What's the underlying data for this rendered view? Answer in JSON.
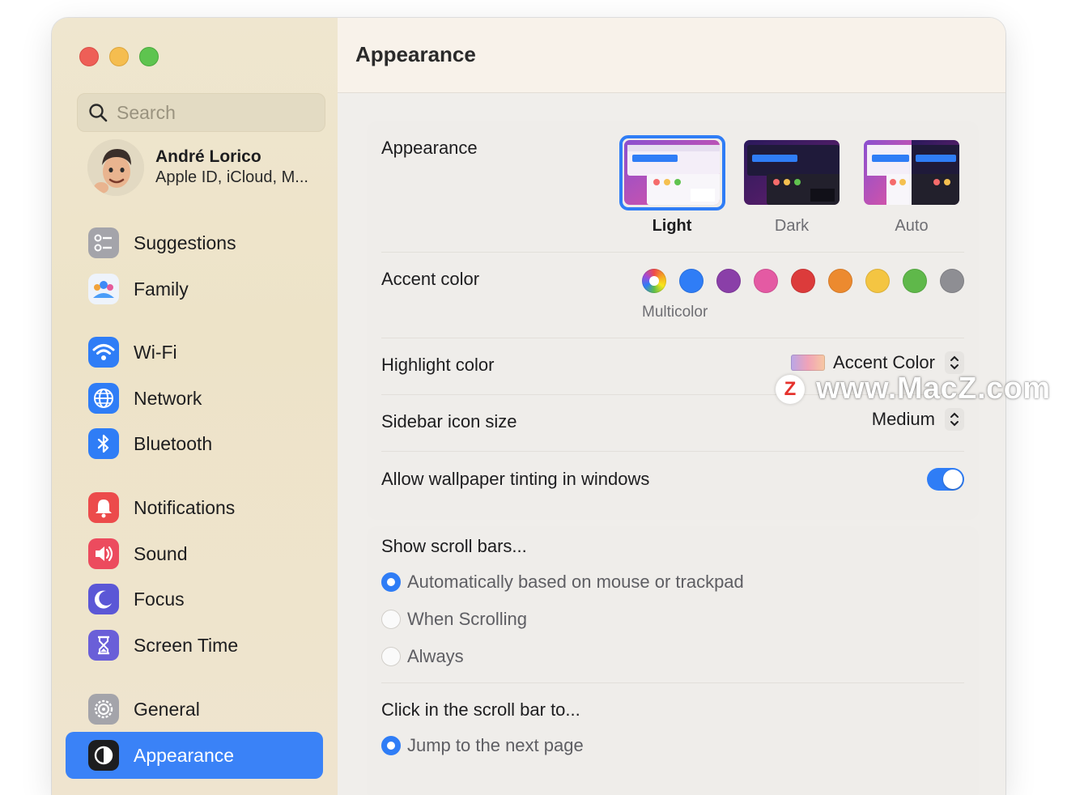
{
  "sidebar": {
    "search_placeholder": "Search",
    "profile": {
      "name": "André Lorico",
      "subtitle": "Apple ID, iCloud, M..."
    },
    "items": [
      {
        "label": "Suggestions",
        "icon": "suggestions-icon",
        "color": "#9a9aa0"
      },
      {
        "label": "Family",
        "icon": "family-icon",
        "color": "#e9f0fb"
      },
      {
        "label": "Wi-Fi",
        "icon": "wifi-icon",
        "color": "#2f7df6"
      },
      {
        "label": "Network",
        "icon": "globe-icon",
        "color": "#2f7df6"
      },
      {
        "label": "Bluetooth",
        "icon": "bluetooth-icon",
        "color": "#2f7df6"
      },
      {
        "label": "Notifications",
        "icon": "bell-icon",
        "color": "#ec4b4b"
      },
      {
        "label": "Sound",
        "icon": "speaker-icon",
        "color": "#ec4b5e"
      },
      {
        "label": "Focus",
        "icon": "moon-icon",
        "color": "#5b57d6"
      },
      {
        "label": "Screen Time",
        "icon": "hourglass-icon",
        "color": "#6a5fd8"
      },
      {
        "label": "General",
        "icon": "gear-icon",
        "color": "#9a9aa0"
      },
      {
        "label": "Appearance",
        "icon": "appearance-icon",
        "color": "#1d1d1f",
        "active": true
      }
    ]
  },
  "header": {
    "title": "Appearance"
  },
  "appearance": {
    "label": "Appearance",
    "options": [
      {
        "label": "Light",
        "selected": true
      },
      {
        "label": "Dark",
        "selected": false
      },
      {
        "label": "Auto",
        "selected": false
      }
    ]
  },
  "accent": {
    "label": "Accent color",
    "caption": "Multicolor",
    "colors": [
      "multicolor",
      "#2f7df6",
      "#8a3fa8",
      "#e45aa3",
      "#dc3b3b",
      "#ec8a2f",
      "#f4c542",
      "#5fb84a",
      "#8e8e93"
    ]
  },
  "highlight": {
    "label": "Highlight color",
    "value": "Accent Color"
  },
  "sidebar_icon_size": {
    "label": "Sidebar icon size",
    "value": "Medium"
  },
  "wallpaper_tinting": {
    "label": "Allow wallpaper tinting in windows",
    "on": true
  },
  "scroll_bars": {
    "title": "Show scroll bars...",
    "options": [
      {
        "label": "Automatically based on mouse or trackpad",
        "selected": true
      },
      {
        "label": "When Scrolling",
        "selected": false
      },
      {
        "label": "Always",
        "selected": false
      }
    ]
  },
  "click_scroll": {
    "title": "Click in the scroll bar to...",
    "options": [
      {
        "label": "Jump to the next page",
        "selected": true
      }
    ]
  },
  "watermark": {
    "text": "www.MacZ.com",
    "logo": "Z"
  }
}
